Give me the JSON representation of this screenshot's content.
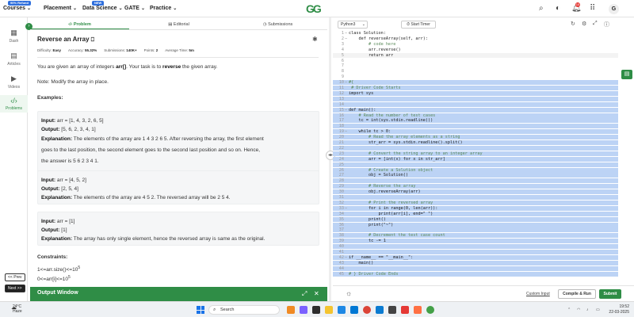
{
  "topnav": {
    "promo_badge": "90% Refund",
    "new_badge": "NEW",
    "items": [
      {
        "label": "Courses"
      },
      {
        "label": "Placement"
      },
      {
        "label": "Data Science"
      },
      {
        "label": "GATE"
      },
      {
        "label": "Practice"
      }
    ],
    "logo": "GG",
    "notification_count": "10",
    "avatar_letter": "G",
    "icons": [
      "search-icon",
      "theme-toggle-icon",
      "bell-icon",
      "more-options-icon"
    ]
  },
  "leftbar": {
    "items": [
      {
        "label": "Dash",
        "icon": "dashboard-icon"
      },
      {
        "label": "Articles",
        "icon": "articles-icon"
      },
      {
        "label": "Videos",
        "icon": "videos-icon"
      },
      {
        "label": "Problems",
        "icon": "problems-icon"
      }
    ],
    "prev_label": "<< Prev",
    "next_label": "Next >>"
  },
  "tabs": [
    {
      "label": "Problem",
      "icon": "code-icon"
    },
    {
      "label": "Editorial",
      "icon": "document-icon"
    },
    {
      "label": "Submissions",
      "icon": "clock-icon"
    }
  ],
  "problem": {
    "title": "Reverse an Array",
    "meta": [
      {
        "label": "Difficulty:",
        "value": "Easy"
      },
      {
        "label": "Accuracy:",
        "value": "55.32%"
      },
      {
        "label": "Submissions:",
        "value": "140K+"
      },
      {
        "label": "Points:",
        "value": "2"
      },
      {
        "label": "Average Time:",
        "value": "5m"
      }
    ],
    "desc_pre": "You are given an array of integers ",
    "desc_arr": "arr[]",
    "desc_mid": ". Your task is to ",
    "desc_reverse": "reverse",
    "desc_post": " the given array.",
    "note": "Note: Modify the array in place.",
    "examples_heading": "Examples:",
    "input_label": "Input:",
    "output_label": "Output:",
    "explanation_label": "Explanation:",
    "examples": [
      {
        "input": "arr = [1, 4, 3, 2, 6, 5]",
        "output": "[5, 6, 2, 3, 4, 1]",
        "explanation_lines": [
          "The elements of the array are 1 4 3 2 6 5. After reversing the array, the first element",
          "goes to the last position, the second element goes to the second last position and so on. Hence,",
          "the answer is 5 6 2 3 4 1."
        ]
      },
      {
        "input": "arr = [4, 5, 2]",
        "output": "[2, 5, 4]",
        "explanation_lines": [
          "The elements of the array are 4 5 2. The reversed array will be 2 5 4."
        ]
      },
      {
        "input": "arr = [1]",
        "output": "[1]",
        "explanation_lines": [
          "The array has only single element, hence the reversed array is same as the original."
        ]
      }
    ],
    "constraints_heading": "Constraints:",
    "constraint1": "1<=arr.size()<=10",
    "constraint1_exp": "5",
    "constraint2": "0<=arr[i]<=10",
    "constraint2_exp": "5"
  },
  "output_window": {
    "title": "Output Window"
  },
  "editor": {
    "language": "Python3",
    "timer_label": "Start Timer",
    "lines": [
      {
        "n": "1",
        "f": "−",
        "code": "class Solution:"
      },
      {
        "n": "2",
        "f": "−",
        "code": "    def reverseArray(self, arr):"
      },
      {
        "n": "3",
        "f": "",
        "code": "        # code here"
      },
      {
        "n": "4",
        "f": "",
        "code": "        arr.reverse()"
      },
      {
        "n": "5",
        "f": "",
        "code": "        return arr"
      },
      {
        "n": "6",
        "f": "",
        "code": ""
      },
      {
        "n": "7",
        "f": "",
        "code": ""
      },
      {
        "n": "8",
        "f": "",
        "code": ""
      },
      {
        "n": "9",
        "f": "",
        "code": ""
      },
      {
        "n": "10",
        "f": "−",
        "code": "#{"
      },
      {
        "n": "11",
        "f": "",
        "code": " # Driver Code Starts"
      },
      {
        "n": "12",
        "f": "",
        "code": "import sys"
      },
      {
        "n": "13",
        "f": "",
        "code": ""
      },
      {
        "n": "14",
        "f": "",
        "code": ""
      },
      {
        "n": "15",
        "f": "−",
        "code": "def main():"
      },
      {
        "n": "16",
        "f": "",
        "code": "    # Read the number of test cases"
      },
      {
        "n": "17",
        "f": "",
        "code": "    tc = int(sys.stdin.readline())"
      },
      {
        "n": "18",
        "f": "",
        "code": ""
      },
      {
        "n": "19",
        "f": "−",
        "code": "    while tc > 0:"
      },
      {
        "n": "20",
        "f": "",
        "code": "        # Read the array elements as a string"
      },
      {
        "n": "21",
        "f": "",
        "code": "        str_arr = sys.stdin.readline().split()"
      },
      {
        "n": "22",
        "f": "",
        "code": ""
      },
      {
        "n": "23",
        "f": "",
        "code": "        # Convert the string array to an integer array"
      },
      {
        "n": "24",
        "f": "",
        "code": "        arr = [int(x) for x in str_arr]"
      },
      {
        "n": "25",
        "f": "",
        "code": ""
      },
      {
        "n": "26",
        "f": "",
        "code": "        # Create a Solution object"
      },
      {
        "n": "27",
        "f": "",
        "code": "        obj = Solution()"
      },
      {
        "n": "28",
        "f": "",
        "code": ""
      },
      {
        "n": "29",
        "f": "",
        "code": "        # Reverse the array"
      },
      {
        "n": "30",
        "f": "",
        "code": "        obj.reverseArray(arr)"
      },
      {
        "n": "31",
        "f": "",
        "code": ""
      },
      {
        "n": "32",
        "f": "",
        "code": "        # Print the reversed array"
      },
      {
        "n": "33",
        "f": "−",
        "code": "        for i in range(0, len(arr)):"
      },
      {
        "n": "34",
        "f": "",
        "code": "            print(arr[i], end=\" \")"
      },
      {
        "n": "35",
        "f": "",
        "code": "        print()"
      },
      {
        "n": "36",
        "f": "",
        "code": "        print(\"~\")"
      },
      {
        "n": "37",
        "f": "",
        "code": ""
      },
      {
        "n": "38",
        "f": "",
        "code": "        # Decrement the test case count"
      },
      {
        "n": "39",
        "f": "",
        "code": "        tc -= 1"
      },
      {
        "n": "40",
        "f": "",
        "code": ""
      },
      {
        "n": "41",
        "f": "",
        "code": ""
      },
      {
        "n": "42",
        "f": "−",
        "code": "if __name__ == \"__main__\":"
      },
      {
        "n": "43",
        "f": "",
        "code": "    main()"
      },
      {
        "n": "44",
        "f": "",
        "code": ""
      },
      {
        "n": "45",
        "f": "",
        "code": "# } Driver Code Ends"
      }
    ],
    "custom_input": "Custom Input",
    "compile_run": "Compile & Run",
    "submit": "Submit"
  },
  "taskbar": {
    "temp": "24°C",
    "weather": "Haze",
    "search_placeholder": "Search",
    "time": "19:52",
    "date": "22-03-2025"
  },
  "colors": {
    "brand_green": "#2f8d46",
    "selection_blue": "#bcd3f5",
    "promo_blue": "#2f6fdd"
  }
}
